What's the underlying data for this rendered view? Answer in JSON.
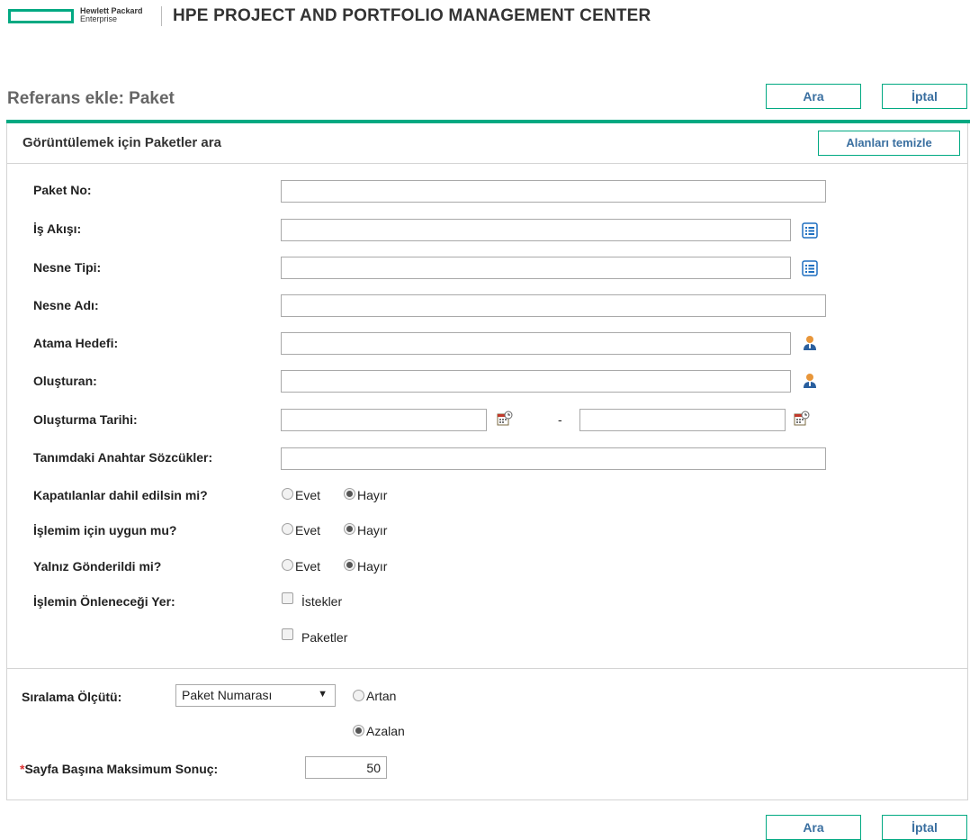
{
  "header": {
    "logo_line1": "Hewlett Packard",
    "logo_line2": "Enterprise",
    "app_title": "HPE PROJECT AND PORTFOLIO MANAGEMENT CENTER"
  },
  "page": {
    "title": "Referans ekle: Paket",
    "search_label": "Ara",
    "cancel_label": "İptal"
  },
  "panel": {
    "title": "Görüntülemek için Paketler ara",
    "clear_label": "Alanları temizle"
  },
  "fields": {
    "package_no": {
      "label": "Paket No:",
      "value": ""
    },
    "workflow": {
      "label": "İş Akışı:",
      "value": ""
    },
    "object_type": {
      "label": "Nesne Tipi:",
      "value": ""
    },
    "object_name": {
      "label": "Nesne Adı:",
      "value": ""
    },
    "assigned_to": {
      "label": "Atama Hedefi:",
      "value": ""
    },
    "created_by": {
      "label": "Oluşturan:",
      "value": ""
    },
    "creation_date": {
      "label": "Oluşturma Tarihi:",
      "from": "",
      "to": "",
      "dash": "-"
    },
    "keywords": {
      "label": "Tanımdaki Anahtar Sözcükler:",
      "value": ""
    }
  },
  "radios": {
    "yes": "Evet",
    "no": "Hayır",
    "include_closed": {
      "label": "Kapatılanlar dahil edilsin mi?",
      "selected": "Hayır"
    },
    "eligible": {
      "label": "İşlemim için uygun mu?",
      "selected": "Hayır"
    },
    "only_submitted": {
      "label": "Yalnız Gönderildi mi?",
      "selected": "Hayır"
    }
  },
  "blocking": {
    "label": "İşlemin Önleneceği Yer:",
    "options": [
      "İstekler",
      "Paketler"
    ]
  },
  "sorting": {
    "label": "Sıralama Ölçütü:",
    "selected": "Paket Numarası",
    "asc": "Artan",
    "desc": "Azalan",
    "direction": "Azalan"
  },
  "max_results": {
    "required_mark": "*",
    "label": "Sayfa Başına Maksimum Sonuç:",
    "value": "50"
  },
  "icons": {
    "list_picker": "list-icon",
    "user_picker": "user-icon",
    "date_picker": "calendar-icon"
  },
  "colors": {
    "accent": "#01a982",
    "button_text": "#3a6fa0",
    "picker_blue": "#1e6fc0",
    "user_orange": "#e8963a"
  }
}
